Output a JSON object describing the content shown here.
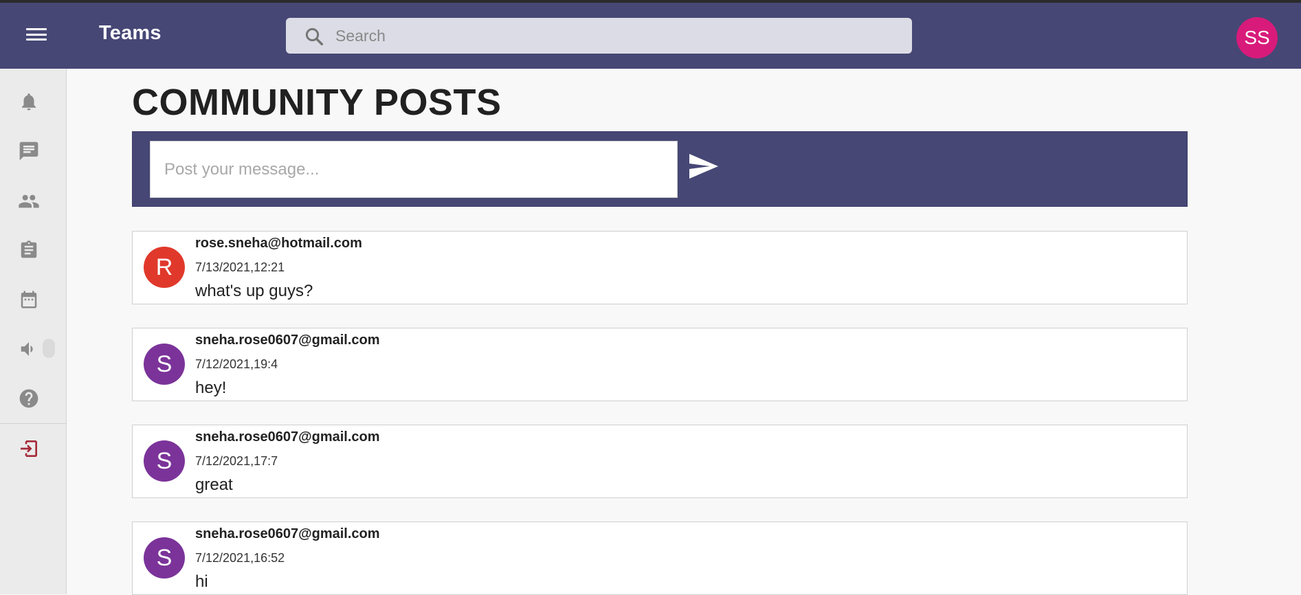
{
  "app": {
    "title": "Teams",
    "user_initials": "SS",
    "accent": "#464775",
    "user_color": "#d81b7a"
  },
  "search": {
    "placeholder": "Search"
  },
  "sidebar": {
    "items": [
      {
        "name": "notifications",
        "icon": "bell-icon"
      },
      {
        "name": "chat",
        "icon": "chat-icon"
      },
      {
        "name": "teams",
        "icon": "people-icon"
      },
      {
        "name": "assignments",
        "icon": "clipboard-icon"
      },
      {
        "name": "calendar",
        "icon": "calendar-icon"
      },
      {
        "name": "audio",
        "icon": "speaker-icon"
      },
      {
        "name": "help",
        "icon": "help-icon"
      },
      {
        "name": "logout",
        "icon": "exit-icon"
      }
    ]
  },
  "main": {
    "title": "COMMUNITY POSTS",
    "composer_placeholder": "Post your message..."
  },
  "posts": [
    {
      "initial": "R",
      "color": "#e0392b",
      "email": "rose.sneha@hotmail.com",
      "time": "7/13/2021,12:21",
      "message": "what's up guys?"
    },
    {
      "initial": "S",
      "color": "#7b3399",
      "email": "sneha.rose0607@gmail.com",
      "time": "7/12/2021,19:4",
      "message": "hey!"
    },
    {
      "initial": "S",
      "color": "#7b3399",
      "email": "sneha.rose0607@gmail.com",
      "time": "7/12/2021,17:7",
      "message": "great"
    },
    {
      "initial": "S",
      "color": "#7b3399",
      "email": "sneha.rose0607@gmail.com",
      "time": "7/12/2021,16:52",
      "message": "hi"
    }
  ]
}
